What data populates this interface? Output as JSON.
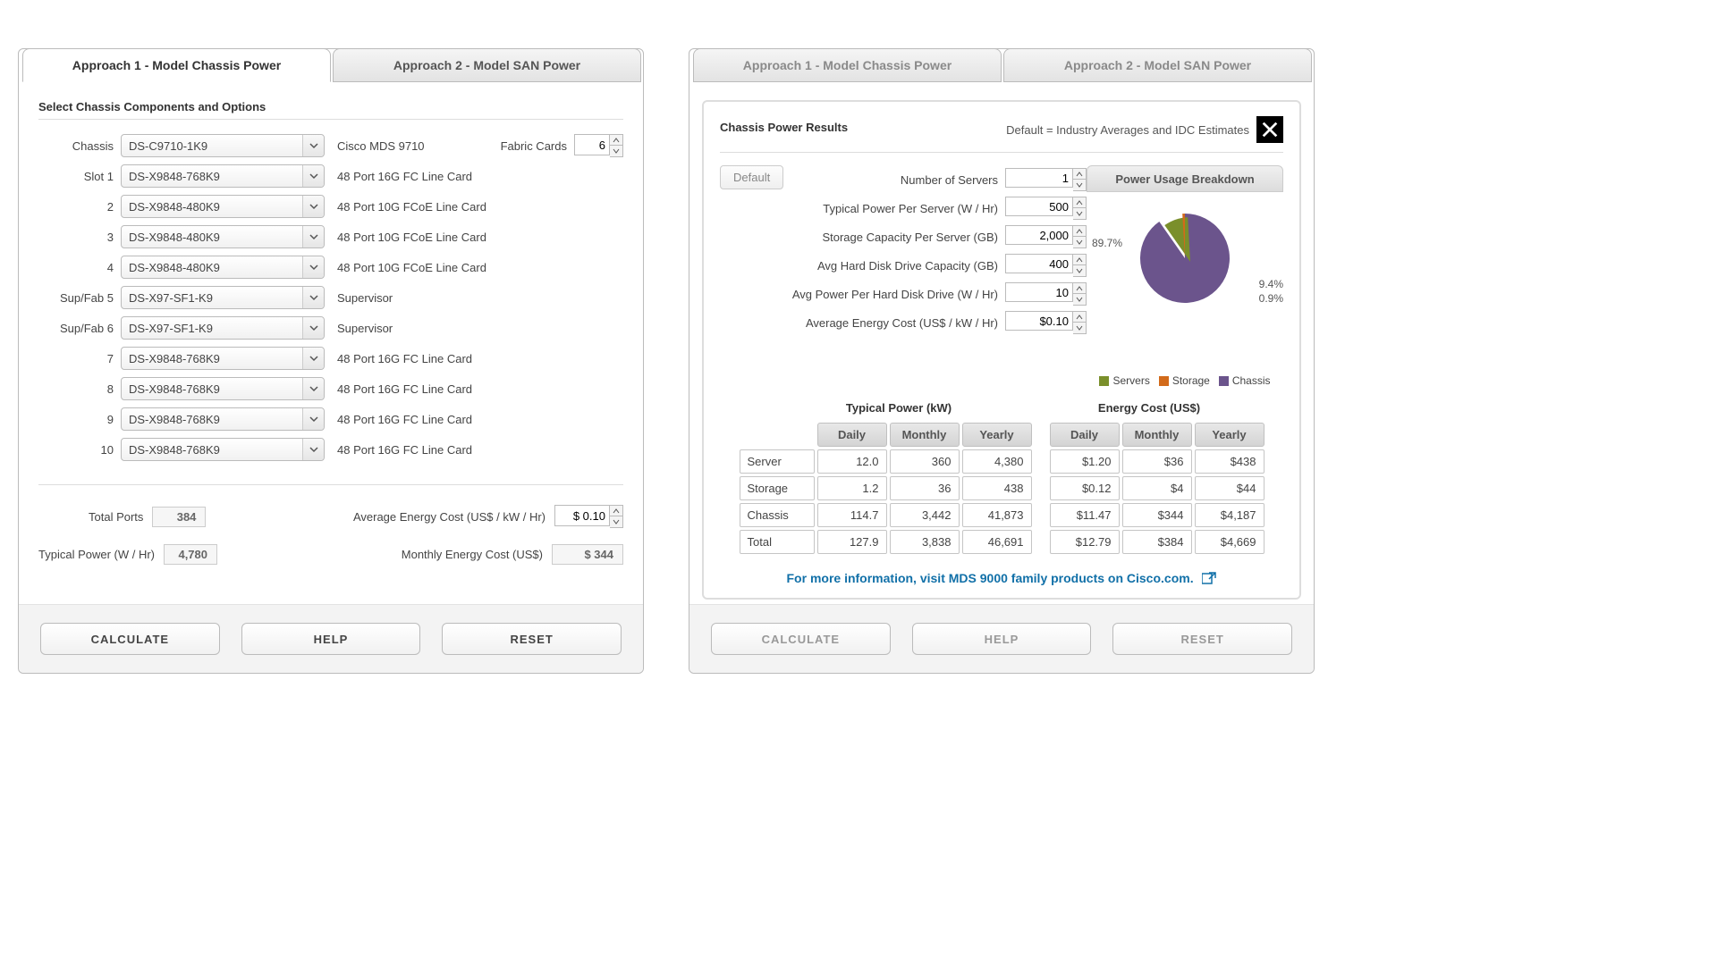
{
  "tabs": {
    "approach1": "Approach 1 - Model Chassis Power",
    "approach2": "Approach 2 - Model SAN Power"
  },
  "left": {
    "section_title": "Select Chassis Components and Options",
    "chassis_label": "Chassis",
    "chassis_value": "DS-C9710-1K9",
    "chassis_desc": "Cisco MDS 9710",
    "fabric_cards_label": "Fabric Cards",
    "fabric_cards_value": "6",
    "slots": [
      {
        "label": "Slot 1",
        "value": "DS-X9848-768K9",
        "desc": "48 Port 16G FC Line Card"
      },
      {
        "label": "2",
        "value": "DS-X9848-480K9",
        "desc": "48 Port 10G FCoE Line Card"
      },
      {
        "label": "3",
        "value": "DS-X9848-480K9",
        "desc": "48 Port 10G FCoE Line Card"
      },
      {
        "label": "4",
        "value": "DS-X9848-480K9",
        "desc": "48 Port 10G FCoE Line Card"
      },
      {
        "label": "Sup/Fab 5",
        "value": "DS-X97-SF1-K9",
        "desc": "Supervisor"
      },
      {
        "label": "Sup/Fab 6",
        "value": "DS-X97-SF1-K9",
        "desc": "Supervisor"
      },
      {
        "label": "7",
        "value": "DS-X9848-768K9",
        "desc": "48 Port 16G FC Line Card"
      },
      {
        "label": "8",
        "value": "DS-X9848-768K9",
        "desc": "48 Port 16G FC Line Card"
      },
      {
        "label": "9",
        "value": "DS-X9848-768K9",
        "desc": "48 Port 16G FC Line Card"
      },
      {
        "label": "10",
        "value": "DS-X9848-768K9",
        "desc": "48 Port 16G FC Line Card"
      }
    ],
    "totals": {
      "total_ports_label": "Total Ports",
      "total_ports": "384",
      "typical_power_label": "Typical Power (W / Hr)",
      "typical_power": "4,780",
      "avg_energy_label": "Average Energy Cost (US$ / kW / Hr)",
      "avg_energy": "$ 0.10",
      "monthly_energy_label": "Monthly Energy Cost (US$)",
      "monthly_energy": "$ 344"
    },
    "buttons": {
      "calculate": "CALCULATE",
      "help": "HELP",
      "reset": "RESET"
    }
  },
  "right": {
    "results_title": "Chassis Power Results",
    "default_note": "Default = Industry Averages and IDC Estimates",
    "default_btn": "Default",
    "inputs": [
      {
        "label": "Number of Servers",
        "value": "1"
      },
      {
        "label": "Typical Power Per Server (W / Hr)",
        "value": "500"
      },
      {
        "label": "Storage Capacity Per Server (GB)",
        "value": "2,000"
      },
      {
        "label": "Avg Hard Disk Drive Capacity (GB)",
        "value": "400"
      },
      {
        "label": "Avg Power Per Hard Disk Drive (W / Hr)",
        "value": "10"
      },
      {
        "label": "Average Energy Cost (US$ / kW / Hr)",
        "value": "$0.10"
      }
    ],
    "pie": {
      "title": "Power Usage Breakdown",
      "values": [
        89.7,
        9.4,
        0.9
      ],
      "labels": [
        "Servers",
        "Storage",
        "Chassis"
      ],
      "colors": [
        "#7a8f2b",
        "#d26a1a",
        "#6b548c"
      ],
      "ann": [
        "89.7%",
        "9.4%",
        "0.9%"
      ]
    },
    "legend": {
      "servers": "Servers",
      "storage": "Storage",
      "chassis": "Chassis"
    },
    "table_titles": {
      "left": "Typical Power (kW)",
      "right": "Energy Cost (US$)"
    },
    "headers": [
      "Daily",
      "Monthly",
      "Yearly"
    ],
    "rows_labels": [
      "Server",
      "Storage",
      "Chassis",
      "Total"
    ],
    "power": [
      [
        "12.0",
        "360",
        "4,380"
      ],
      [
        "1.2",
        "36",
        "438"
      ],
      [
        "114.7",
        "3,442",
        "41,873"
      ],
      [
        "127.9",
        "3,838",
        "46,691"
      ]
    ],
    "cost": [
      [
        "$1.20",
        "$36",
        "$438"
      ],
      [
        "$0.12",
        "$4",
        "$44"
      ],
      [
        "$11.47",
        "$344",
        "$4,187"
      ],
      [
        "$12.79",
        "$384",
        "$4,669"
      ]
    ],
    "link_text": "For more information, visit MDS 9000 family products on Cisco.com.",
    "buttons": {
      "calculate": "CALCULATE",
      "help": "HELP",
      "reset": "RESET"
    }
  },
  "chart_data": {
    "type": "pie",
    "title": "Power Usage Breakdown",
    "categories": [
      "Servers",
      "Storage",
      "Chassis"
    ],
    "values": [
      89.7,
      9.4,
      0.9
    ]
  }
}
